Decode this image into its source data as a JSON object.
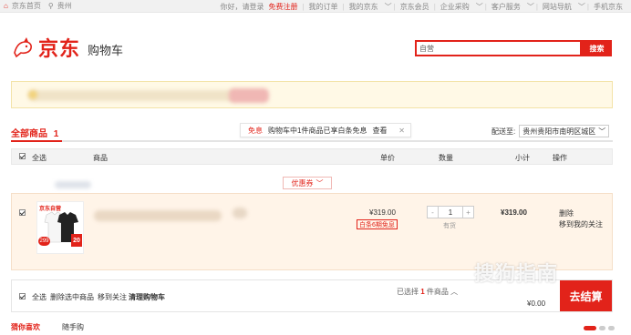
{
  "topbar": {
    "home": "京东首页",
    "location": "贵州",
    "greeting": "你好，请登录",
    "register": "免费注册",
    "links": [
      "我的订单",
      "我的京东",
      "京东会员",
      "企业采购",
      "客户服务",
      "网站导航",
      "手机京东"
    ]
  },
  "header": {
    "logo_text": "京东",
    "page_title": "购物车"
  },
  "search": {
    "value": "自营",
    "button": "搜索"
  },
  "cart": {
    "tab_all": "全部商品",
    "tab_count": "1",
    "tip_tag": "免息",
    "tip_text": "购物车中1件商品已享白条免息",
    "tip_link": "查看",
    "deliver_label": "配送至:",
    "deliver_value": "贵州贵阳市南明区城区"
  },
  "table_header": {
    "select_all": "全选",
    "col_product": "商品",
    "col_price": "单价",
    "col_qty": "数量",
    "col_subtotal": "小计",
    "col_ops": "操作"
  },
  "coupon": {
    "label": "优惠券"
  },
  "item": {
    "brand": "京东自营",
    "badge_price": "299",
    "badge_off": "20",
    "price": "¥319.00",
    "promo": "白条6期免息",
    "quantity": "1",
    "minus": "-",
    "plus": "+",
    "stock": "有货",
    "subtotal": "¥319.00",
    "op_delete": "删除",
    "op_follow": "移到我的关注"
  },
  "bottom": {
    "select_all": "全选",
    "delete_selected": "删除选中商品",
    "move_follow": "移到关注",
    "clear": "清理购物车",
    "selected_prefix": "已选择",
    "selected_count": "1",
    "selected_suffix": "件商品",
    "total": "¥0.00",
    "checkout": "去结算"
  },
  "guess": {
    "tab1": "猜你喜欢",
    "tab2": "随手购"
  },
  "watermark": "搜狗指南",
  "colors": {
    "brand_red": "#e2231a",
    "notice_bg": "#fff9e6",
    "item_bg": "#fff4e8"
  }
}
